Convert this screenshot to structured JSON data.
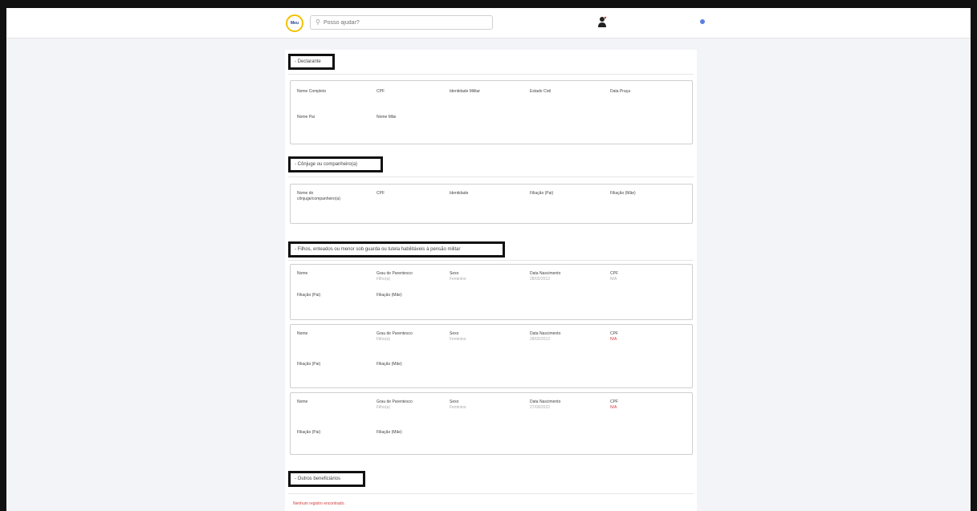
{
  "topbar": {
    "logo_text": "Meu",
    "search_placeholder": "Posso ajudar?",
    "search_icon": "search-icon",
    "user_icon": "person-icon"
  },
  "sections": {
    "declarante": {
      "title": "- Declarante",
      "labels": [
        "Nome Completo",
        "CPF",
        "Identidade Militar",
        "Estado Civil",
        "Data Praça",
        "Nome Pai",
        "Nome Mãe"
      ]
    },
    "conjuge": {
      "title": "- Cônjuge ou companheiro(a)",
      "label_nome": "Nome do cônjuge/companheiro(a)",
      "labels": [
        "CPF",
        "Identidade",
        "Filiação (Pai)",
        "Filiação (Mãe)"
      ]
    },
    "filhos": {
      "title": "- Filhos, enteados ou menor sob guarda ou tutela habilitáveis à pensão militar",
      "labels": {
        "nome": "Nome",
        "grau": "Grau de Parentesco",
        "sexo": "Sexo",
        "nascimento": "Data Nascimento",
        "cpf": "CPF",
        "pai": "Filiação (Pai)",
        "mae": "Filiação (Mãe)"
      },
      "items": [
        {
          "grau": "Filho(a)",
          "sexo": "Feminino",
          "nascimento": "28/02/2012",
          "cpf": "N/A"
        },
        {
          "grau": "Filho(a)",
          "sexo": "Feminino",
          "nascimento": "28/02/2012",
          "cpf": "N/A"
        },
        {
          "grau": "Filho(a)",
          "sexo": "Feminino",
          "nascimento": "27/09/2022",
          "cpf": "N/A"
        }
      ]
    },
    "outros": {
      "title": "- Outros beneficiários",
      "empty_message": "Nenhum registro encontrado."
    }
  },
  "colors": {
    "frame": "#111111",
    "highlight_border": "#111111",
    "na_red": "#d23c3c",
    "logo_ring": "#f2c200"
  }
}
